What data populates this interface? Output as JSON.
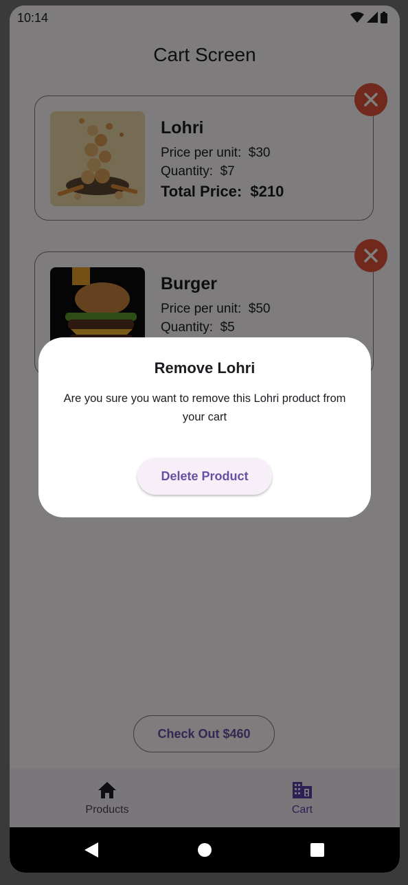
{
  "status_bar": {
    "time": "10:14"
  },
  "screen": {
    "title": "Cart Screen"
  },
  "cart_items": [
    {
      "name": "Lohri",
      "price_line": "Price per unit:  $30",
      "quantity_line": "Quantity:  $7",
      "total_line": "Total Price:  $210"
    },
    {
      "name": "Burger",
      "price_line": "Price per unit:  $50",
      "quantity_line": "Quantity:  $5"
    }
  ],
  "checkout": {
    "label": "Check Out $460"
  },
  "bottom_nav": {
    "products_label": "Products",
    "cart_label": "Cart",
    "selected": "Cart"
  },
  "dialog": {
    "title": "Remove Lohri",
    "message": "Are you sure you want to remove this Lohri product from your cart",
    "button_label": "Delete Product"
  },
  "colors": {
    "accent": "#6750a4",
    "remove_button": "#e5533b",
    "scrim": "#000000"
  },
  "icons": {
    "remove": "close-icon",
    "products_tab": "home-icon",
    "cart_tab": "business-icon"
  }
}
